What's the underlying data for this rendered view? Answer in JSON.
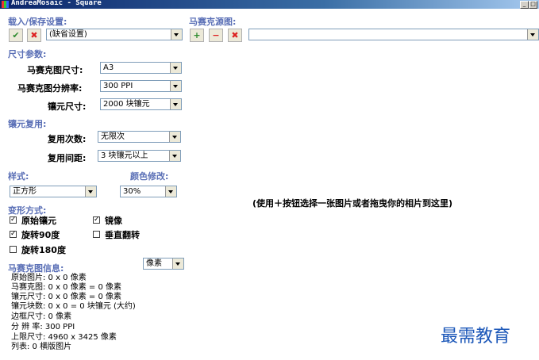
{
  "window": {
    "title": "AndreaMosaic - Square"
  },
  "load_save": {
    "heading": "载入/保存设置:",
    "preset_value": "(缺省设置)"
  },
  "source": {
    "heading": "马赛克源图:",
    "path_value": "",
    "drop_hint": "(使用＋按钮选择一张图片或者拖曳你的相片到这里)"
  },
  "size_params": {
    "heading": "尺寸参数:",
    "mosaic_size_label": "马赛克图尺寸:",
    "mosaic_size_value": "A3",
    "resolution_label": "马赛克图分辨率:",
    "resolution_value": "300 PPI",
    "tile_size_label": "镶元尺寸:",
    "tile_size_value": "2000 块镶元"
  },
  "tile_reuse": {
    "heading": "镶元复用:",
    "reuse_count_label": "复用次数:",
    "reuse_count_value": "无限次",
    "reuse_distance_label": "复用间距:",
    "reuse_distance_value": "3 块镶元以上"
  },
  "style": {
    "heading": "样式:",
    "value": "正方形"
  },
  "color_mod": {
    "heading": "颜色修改:",
    "value": "30%"
  },
  "transform": {
    "heading": "变形方式:",
    "options": [
      {
        "label": "原始镶元",
        "checked": true
      },
      {
        "label": "镜像",
        "checked": true
      },
      {
        "label": "旋转90度",
        "checked": true
      },
      {
        "label": "垂直翻转",
        "checked": false
      },
      {
        "label": "旋转180度",
        "checked": false
      }
    ]
  },
  "mosaic_info": {
    "heading": "马赛克图信息:",
    "unit_value": "像素",
    "lines": [
      "原始图片: 0 x 0 像素",
      "马赛克图: 0 x 0 像素 = 0 像素",
      "镶元尺寸: 0 x 0 像素 = 0 像素",
      "镶元块数: 0 x 0 = 0 块镶元 (大约)",
      "边框尺寸: 0 像素",
      "分 辨 率: 300 PPI",
      "上限尺寸: 4960 x 3425 像素",
      "列表:  0 横版图片"
    ]
  },
  "watermark": {
    "text": "最需教育"
  }
}
